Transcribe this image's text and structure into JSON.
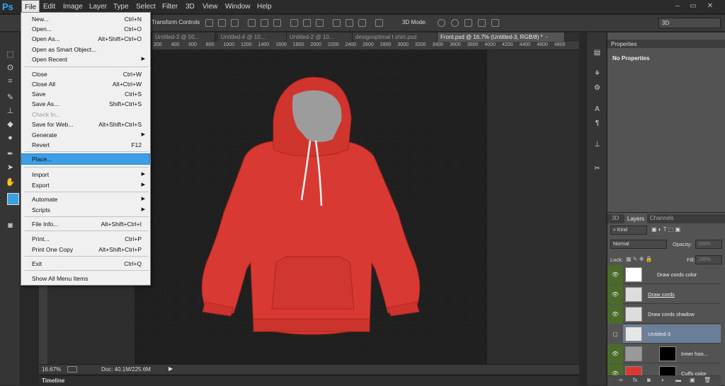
{
  "app": {
    "logo": "Ps"
  },
  "menubar": [
    "File",
    "Edit",
    "Image",
    "Layer",
    "Type",
    "Select",
    "Filter",
    "3D",
    "View",
    "Window",
    "Help"
  ],
  "window_controls": [
    "–",
    "▭",
    "✕"
  ],
  "options": {
    "transform_label": "Transform Controls",
    "mode_label": "3D Mode:",
    "workspace": "3D"
  },
  "tabs": [
    {
      "label": "Untitled-3 @ 50...",
      "active": false
    },
    {
      "label": "Untitled-4 @ 10...",
      "active": false
    },
    {
      "label": "Untitled-2 @ 10...",
      "active": false
    },
    {
      "label": "designoptimal t shirt.psd",
      "active": false
    },
    {
      "label": "Front.psd @ 16.7% (Untitled-3, RGB/8) *",
      "active": true
    }
  ],
  "ruler_ticks": [
    "200",
    "400",
    "600",
    "800",
    "1000",
    "1200",
    "1400",
    "1600",
    "1800",
    "2000",
    "2200",
    "2400",
    "2600",
    "2800",
    "3000",
    "3200",
    "3400",
    "3600",
    "3800",
    "4000",
    "4200",
    "4400",
    "4600",
    "4800"
  ],
  "status": {
    "zoom": "16.67%",
    "doc": "Doc: 40.1M/225.6M"
  },
  "timeline": {
    "label": "Timeline"
  },
  "properties": {
    "title": "Properties",
    "empty": "No Properties"
  },
  "layers_panel": {
    "tabs": [
      "3D",
      "Layers",
      "Channels"
    ],
    "kind": "Kind",
    "blend": "Normal",
    "opacity_label": "Opacity:",
    "opacity": "100%",
    "lock_label": "Lock:",
    "fill_label": "Fill:",
    "fill": "100%",
    "layers": [
      {
        "name": "Draw cords color",
        "visible": true,
        "selected": false
      },
      {
        "name": "Draw cords",
        "visible": true,
        "selected": false
      },
      {
        "name": "Draw cords shadow",
        "visible": true,
        "selected": false
      },
      {
        "name": "Untitled-3",
        "visible": false,
        "selected": true
      },
      {
        "name": "Inner hoo...",
        "visible": true,
        "selected": false
      },
      {
        "name": "Cuffs color",
        "visible": true,
        "selected": false
      }
    ]
  },
  "file_menu": [
    {
      "label": "New...",
      "shortcut": "Ctrl+N"
    },
    {
      "label": "Open...",
      "shortcut": "Ctrl+O"
    },
    {
      "label": "Open As...",
      "shortcut": "Alt+Shift+Ctrl+O"
    },
    {
      "label": "Open as Smart Object...",
      "shortcut": ""
    },
    {
      "label": "Open Recent",
      "shortcut": "",
      "submenu": true
    },
    {
      "label": "Close",
      "shortcut": "Ctrl+W"
    },
    {
      "label": "Close All",
      "shortcut": "Alt+Ctrl+W"
    },
    {
      "label": "Save",
      "shortcut": "Ctrl+S"
    },
    {
      "label": "Save As...",
      "shortcut": "Shift+Ctrl+S"
    },
    {
      "label": "Check In...",
      "shortcut": "",
      "disabled": true
    },
    {
      "label": "Save for Web...",
      "shortcut": "Alt+Shift+Ctrl+S"
    },
    {
      "label": "Generate",
      "shortcut": "",
      "submenu": true
    },
    {
      "label": "Revert",
      "shortcut": "F12"
    },
    {
      "label": "Place...",
      "shortcut": "",
      "highlight": true
    },
    {
      "label": "Import",
      "shortcut": "",
      "submenu": true
    },
    {
      "label": "Export",
      "shortcut": "",
      "submenu": true
    },
    {
      "label": "Automate",
      "shortcut": "",
      "submenu": true
    },
    {
      "label": "Scripts",
      "shortcut": "",
      "submenu": true
    },
    {
      "label": "File Info...",
      "shortcut": "Alt+Shift+Ctrl+I"
    },
    {
      "label": "Print...",
      "shortcut": "Ctrl+P"
    },
    {
      "label": "Print One Copy",
      "shortcut": "Alt+Shift+Ctrl+P"
    },
    {
      "label": "Exit",
      "shortcut": "Ctrl+Q"
    },
    {
      "label": "Show All Menu Items",
      "shortcut": ""
    }
  ],
  "colors": {
    "accent": "#3d9ee6",
    "hoodie": "#d83a33",
    "visible_eye": "#4b6b2a",
    "selected_layer": "#6c7f99"
  }
}
